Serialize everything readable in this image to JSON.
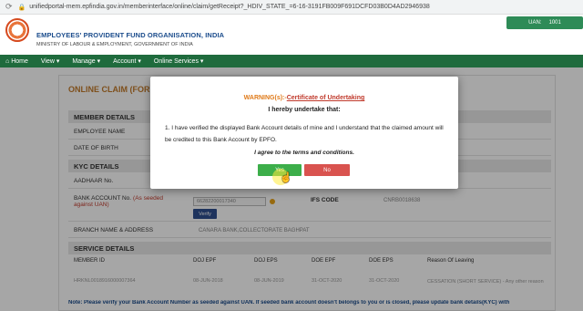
{
  "browser": {
    "url": "unifiedportal-mem.epfindia.gov.in/memberinterface/online/claim/getReceipt?_HDIV_STATE_=6-16-3191FB009F691DCFD03B0D4AD2946938"
  },
  "header": {
    "org_name": "EMPLOYEES' PROVIDENT FUND ORGANISATION, INDIA",
    "ministry": "MINISTRY OF LABOUR & EMPLOYMENT, GOVERNMENT OF INDIA",
    "uan_label": "UAN: ",
    "uan_value": "1001"
  },
  "nav": {
    "items": [
      {
        "label": "Home",
        "icon": "home-icon"
      },
      {
        "label": "View ▾"
      },
      {
        "label": "Manage ▾"
      },
      {
        "label": "Account ▾"
      },
      {
        "label": "Online Services ▾"
      }
    ]
  },
  "page": {
    "title": "ONLINE CLAIM (FOR",
    "member_details": "MEMBER DETAILS",
    "employee_name": "EMPLOYEE NAME",
    "dob": "DATE OF BIRTH",
    "kyc_details": "KYC DETAILS",
    "aadhaar": "AADHAAR No.",
    "bank_account_label": "BANK ACCOUNT No.",
    "bank_account_note": "(As seeded against UAN)",
    "bank_account_value": "66282200017340",
    "verify_label": "Verify",
    "ifs_label": "IFS CODE",
    "ifs_value": "CNRB0018638",
    "branch_label": "BRANCH NAME & ADDRESS",
    "branch_value": "CANARA BANK,COLLECTORATE BAGHPAT",
    "service_details": "SERVICE DETAILS",
    "service_headers": [
      "MEMBER ID",
      "DOJ EPF",
      "DOJ EPS",
      "DOE EPF",
      "DOE EPS",
      "Reason Of Leaving"
    ],
    "service_row": [
      "HRKNL0018916000007364",
      "08-JUN-2018",
      "08-JUN-2019",
      "31-OCT-2020",
      "31-OCT-2020",
      "CESSATION (SHORT SERVICE) - Any other reason"
    ],
    "note": "Note: Please verify your Bank Account Number as seeded against UAN. If seeded bank account doesn't belongs to you or is closed, please update bank details(KYC) with"
  },
  "modal": {
    "warning": "WARNING(s):-",
    "certificate": "Certificate of Undertaking",
    "undertake": "I hereby undertake that:",
    "statement": "1. I have verified the displayed Bank Account details of mine and I understand that the claimed amount will be credited to this Bank Account by EPFO.",
    "agree": "I agree to the terms and conditions.",
    "yes_label": "Yes",
    "no_label": "No"
  }
}
